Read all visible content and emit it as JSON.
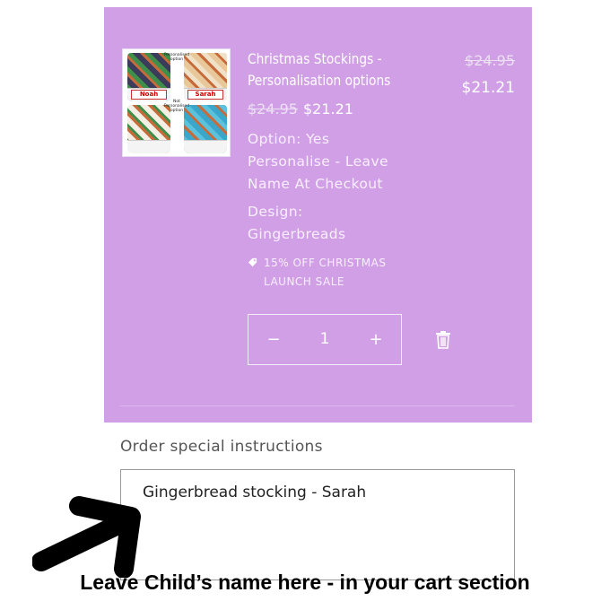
{
  "product": {
    "title_line1": "Christmas Stockings -",
    "title_line2": "Personalisation options",
    "original_price": "$24.95",
    "sale_price": "$21.21",
    "option_line1": "Option: Yes",
    "option_line2": "Personalise - Leave",
    "option_line3": "Name At Checkout",
    "design_line1": "Design:",
    "design_line2": "Gingerbreads",
    "discount_line1": "15% OFF CHRISTMAS",
    "discount_line2": "LAUNCH SALE",
    "image": {
      "name_tag_1": "Noah",
      "name_tag_2": "Sarah",
      "caption_personalised": "Personalised option",
      "caption_not_personalised": "Not Personalised option"
    }
  },
  "quantity": {
    "decrease_label": "−",
    "value": "1",
    "increase_label": "+"
  },
  "instructions": {
    "label": "Order special instructions",
    "value": "Gingerbread stocking - Sarah"
  },
  "annotation": {
    "caption": "Leave Child’s name here - in your cart section"
  },
  "colors": {
    "panel": "#d19fe6",
    "text_on_panel": "#ffffff",
    "annotation": "#000000"
  },
  "icons": [
    "tag-icon",
    "trash-icon",
    "arrow-icon"
  ]
}
